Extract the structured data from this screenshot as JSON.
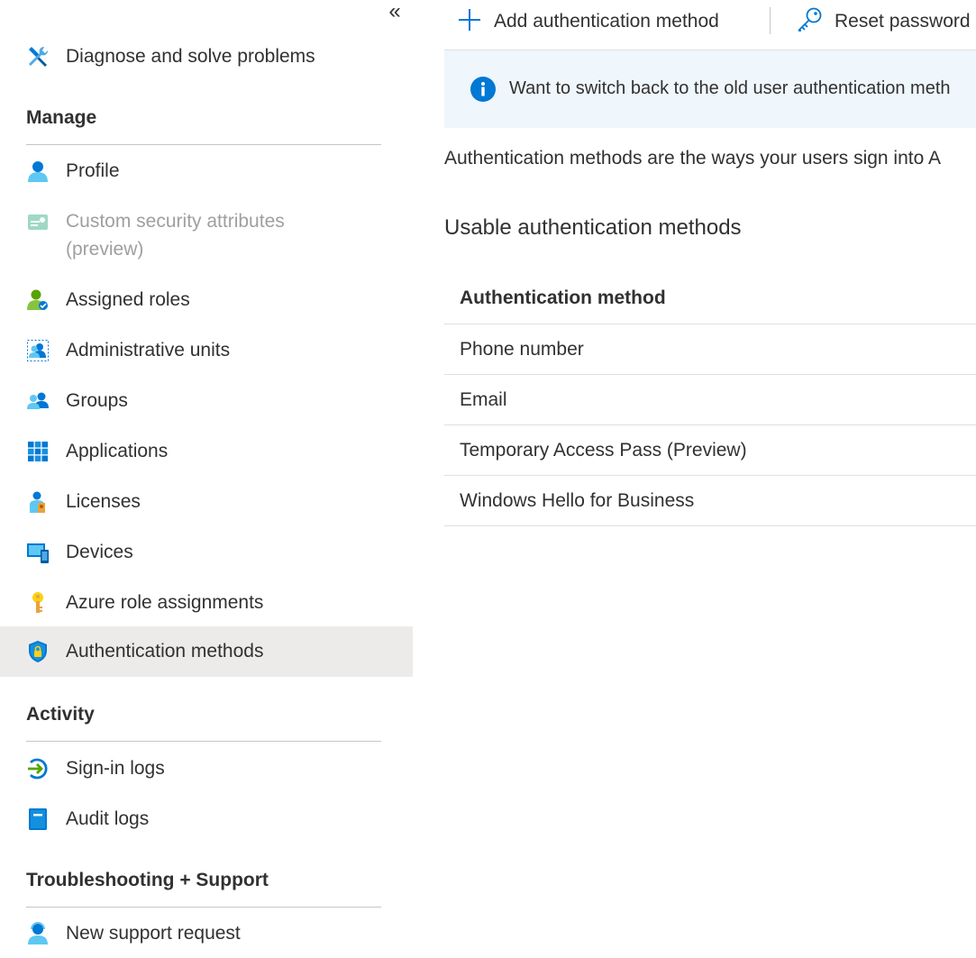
{
  "sidebar": {
    "collapse_glyph": "«",
    "diagnose": "Diagnose and solve problems",
    "sections": {
      "manage": "Manage",
      "activity": "Activity",
      "troubleshooting": "Troubleshooting + Support"
    },
    "items": {
      "profile": "Profile",
      "custom_security": "Custom security attributes (preview)",
      "assigned_roles": "Assigned roles",
      "admin_units": "Administrative units",
      "groups": "Groups",
      "applications": "Applications",
      "licenses": "Licenses",
      "devices": "Devices",
      "azure_roles": "Azure role assignments",
      "auth_methods": "Authentication methods",
      "signin_logs": "Sign-in logs",
      "audit_logs": "Audit logs",
      "support_request": "New support request"
    },
    "active_item": "Authentication methods"
  },
  "toolbar": {
    "add_label": "Add authentication method",
    "reset_label": "Reset password"
  },
  "banner": {
    "text": "Want to switch back to the old user authentication meth"
  },
  "main": {
    "description": "Authentication methods are the ways your users sign into A",
    "subheading": "Usable authentication methods",
    "table": {
      "header": "Authentication method",
      "rows": [
        "Phone number",
        "Email",
        "Temporary Access Pass (Preview)",
        "Windows Hello for Business"
      ]
    }
  },
  "colors": {
    "accent": "#0078d4",
    "active_bg": "#edebe9",
    "banner_bg": "#eff6fc",
    "disabled_text": "#a19f9d"
  },
  "icons": {
    "diagnose": "wrench-screwdriver-icon",
    "profile": "person-icon",
    "custom_security": "id-card-icon",
    "assigned_roles": "person-role-icon",
    "admin_units": "admin-units-icon",
    "groups": "people-icon",
    "applications": "app-grid-icon",
    "licenses": "license-icon",
    "devices": "devices-icon",
    "azure_roles": "key-icon",
    "auth_methods": "shield-lock-icon",
    "signin_logs": "sign-in-arrow-icon",
    "audit_logs": "book-icon",
    "support": "support-person-icon",
    "add": "plus-icon",
    "reset": "key-outline-icon",
    "info": "info-icon"
  }
}
